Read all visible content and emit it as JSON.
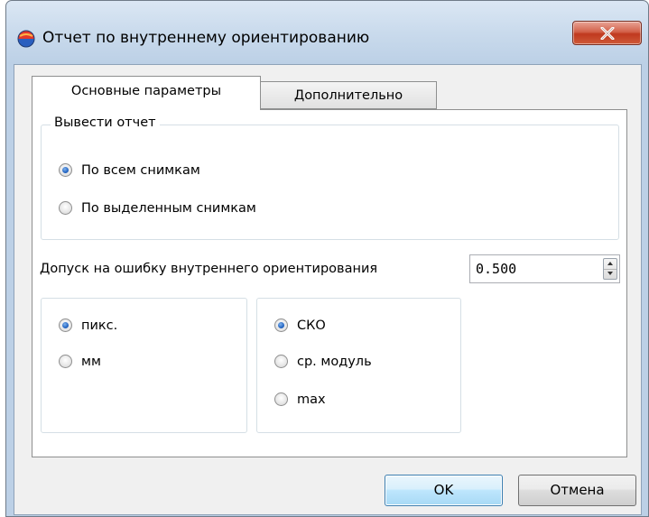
{
  "window": {
    "title": "Отчет по внутреннему ориентированию",
    "icon": "app-globe-icon",
    "close_icon": "close-icon"
  },
  "tabs": [
    {
      "label": "Основные параметры",
      "active": true
    },
    {
      "label": "Дополнительно",
      "active": false
    }
  ],
  "report_group": {
    "title": "Вывести отчет",
    "options": [
      {
        "label": "По всем снимкам",
        "checked": true
      },
      {
        "label": "По выделенным снимкам",
        "checked": false
      }
    ]
  },
  "tolerance": {
    "label": "Допуск на ошибку внутреннего ориентирования",
    "value": "0.500"
  },
  "units_group": {
    "options": [
      {
        "label": "пикс.",
        "checked": true
      },
      {
        "label": "мм",
        "checked": false
      }
    ]
  },
  "metric_group": {
    "options": [
      {
        "label": "СКО",
        "checked": true
      },
      {
        "label": "ср. модуль",
        "checked": false
      },
      {
        "label": "max",
        "checked": false
      }
    ]
  },
  "buttons": {
    "ok": "OK",
    "cancel": "Отмена"
  },
  "colors": {
    "close_button": "#c9452b",
    "title_bar": "#c9daec",
    "ok_button_border": "#3c7fb1",
    "radio_selected": "#2566c3"
  }
}
